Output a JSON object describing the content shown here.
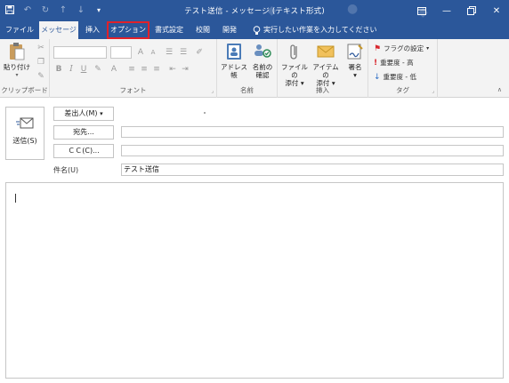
{
  "window": {
    "title": "テスト送信 - メッセージ (テキスト形式)",
    "qat_icons": [
      "save-icon",
      "undo-icon",
      "redo-icon",
      "up-arrow-icon",
      "down-arrow-icon",
      "customize-qat-icon"
    ],
    "controls": [
      "ribbon-display-options-icon",
      "minimize-icon",
      "restore-icon",
      "close-icon"
    ]
  },
  "tabs": [
    {
      "label": "ファイル",
      "active": false,
      "highlighted": false
    },
    {
      "label": "メッセージ",
      "active": true,
      "highlighted": false
    },
    {
      "label": "挿入",
      "active": false,
      "highlighted": false
    },
    {
      "label": "オプション",
      "active": false,
      "highlighted": true
    },
    {
      "label": "書式設定",
      "active": false,
      "highlighted": false
    },
    {
      "label": "校閲",
      "active": false,
      "highlighted": false
    },
    {
      "label": "開発",
      "active": false,
      "highlighted": false
    }
  ],
  "tell_me": "実行したい作業を入力してください",
  "ribbon": {
    "clipboard": {
      "label": "クリップボード",
      "paste": "貼り付け"
    },
    "font": {
      "label": "フォント"
    },
    "names": {
      "label": "名前",
      "address_book": "アドレス帳",
      "check_names_1": "名前の",
      "check_names_2": "確認"
    },
    "include": {
      "label": "挿入",
      "attach_file_1": "ファイルの",
      "attach_file_2": "添付",
      "attach_item_1": "アイテムの",
      "attach_item_2": "添付",
      "signature": "署名"
    },
    "tags": {
      "label": "タグ",
      "follow_up": "フラグの設定",
      "high_importance": "重要度 - 高",
      "low_importance": "重要度 - 低"
    }
  },
  "compose": {
    "send": "送信(S)",
    "from": "差出人(M)",
    "to": "宛先...",
    "cc": "ＣＣ(C)...",
    "subject_label": "件名(U)",
    "subject_value": "テスト送信"
  },
  "colors": {
    "titlebar": "#2b579a",
    "highlight": "#e0212a",
    "ribbon": "#f3f3f3"
  }
}
